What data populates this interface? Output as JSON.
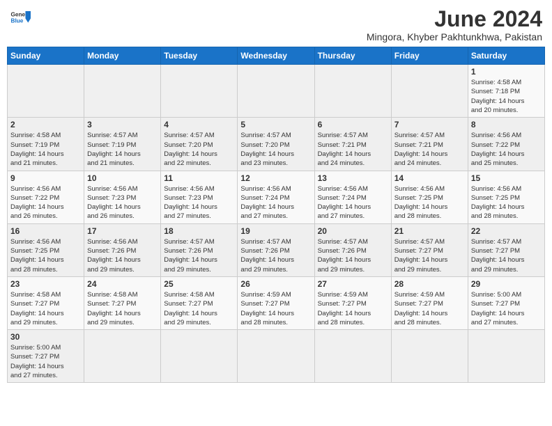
{
  "header": {
    "logo_general": "General",
    "logo_blue": "Blue",
    "month_title": "June 2024",
    "subtitle": "Mingora, Khyber Pakhtunkhwa, Pakistan"
  },
  "weekdays": [
    "Sunday",
    "Monday",
    "Tuesday",
    "Wednesday",
    "Thursday",
    "Friday",
    "Saturday"
  ],
  "weeks": [
    [
      {
        "day": "",
        "info": ""
      },
      {
        "day": "",
        "info": ""
      },
      {
        "day": "",
        "info": ""
      },
      {
        "day": "",
        "info": ""
      },
      {
        "day": "",
        "info": ""
      },
      {
        "day": "",
        "info": ""
      },
      {
        "day": "1",
        "info": "Sunrise: 4:58 AM\nSunset: 7:18 PM\nDaylight: 14 hours\nand 20 minutes."
      }
    ],
    [
      {
        "day": "2",
        "info": "Sunrise: 4:58 AM\nSunset: 7:19 PM\nDaylight: 14 hours\nand 21 minutes."
      },
      {
        "day": "3",
        "info": "Sunrise: 4:57 AM\nSunset: 7:19 PM\nDaylight: 14 hours\nand 21 minutes."
      },
      {
        "day": "4",
        "info": "Sunrise: 4:57 AM\nSunset: 7:20 PM\nDaylight: 14 hours\nand 22 minutes."
      },
      {
        "day": "5",
        "info": "Sunrise: 4:57 AM\nSunset: 7:20 PM\nDaylight: 14 hours\nand 23 minutes."
      },
      {
        "day": "6",
        "info": "Sunrise: 4:57 AM\nSunset: 7:21 PM\nDaylight: 14 hours\nand 24 minutes."
      },
      {
        "day": "7",
        "info": "Sunrise: 4:57 AM\nSunset: 7:21 PM\nDaylight: 14 hours\nand 24 minutes."
      },
      {
        "day": "8",
        "info": "Sunrise: 4:56 AM\nSunset: 7:22 PM\nDaylight: 14 hours\nand 25 minutes."
      }
    ],
    [
      {
        "day": "9",
        "info": "Sunrise: 4:56 AM\nSunset: 7:22 PM\nDaylight: 14 hours\nand 26 minutes."
      },
      {
        "day": "10",
        "info": "Sunrise: 4:56 AM\nSunset: 7:23 PM\nDaylight: 14 hours\nand 26 minutes."
      },
      {
        "day": "11",
        "info": "Sunrise: 4:56 AM\nSunset: 7:23 PM\nDaylight: 14 hours\nand 27 minutes."
      },
      {
        "day": "12",
        "info": "Sunrise: 4:56 AM\nSunset: 7:24 PM\nDaylight: 14 hours\nand 27 minutes."
      },
      {
        "day": "13",
        "info": "Sunrise: 4:56 AM\nSunset: 7:24 PM\nDaylight: 14 hours\nand 27 minutes."
      },
      {
        "day": "14",
        "info": "Sunrise: 4:56 AM\nSunset: 7:25 PM\nDaylight: 14 hours\nand 28 minutes."
      },
      {
        "day": "15",
        "info": "Sunrise: 4:56 AM\nSunset: 7:25 PM\nDaylight: 14 hours\nand 28 minutes."
      }
    ],
    [
      {
        "day": "16",
        "info": "Sunrise: 4:56 AM\nSunset: 7:25 PM\nDaylight: 14 hours\nand 28 minutes."
      },
      {
        "day": "17",
        "info": "Sunrise: 4:56 AM\nSunset: 7:26 PM\nDaylight: 14 hours\nand 29 minutes."
      },
      {
        "day": "18",
        "info": "Sunrise: 4:57 AM\nSunset: 7:26 PM\nDaylight: 14 hours\nand 29 minutes."
      },
      {
        "day": "19",
        "info": "Sunrise: 4:57 AM\nSunset: 7:26 PM\nDaylight: 14 hours\nand 29 minutes."
      },
      {
        "day": "20",
        "info": "Sunrise: 4:57 AM\nSunset: 7:26 PM\nDaylight: 14 hours\nand 29 minutes."
      },
      {
        "day": "21",
        "info": "Sunrise: 4:57 AM\nSunset: 7:27 PM\nDaylight: 14 hours\nand 29 minutes."
      },
      {
        "day": "22",
        "info": "Sunrise: 4:57 AM\nSunset: 7:27 PM\nDaylight: 14 hours\nand 29 minutes."
      }
    ],
    [
      {
        "day": "23",
        "info": "Sunrise: 4:58 AM\nSunset: 7:27 PM\nDaylight: 14 hours\nand 29 minutes."
      },
      {
        "day": "24",
        "info": "Sunrise: 4:58 AM\nSunset: 7:27 PM\nDaylight: 14 hours\nand 29 minutes."
      },
      {
        "day": "25",
        "info": "Sunrise: 4:58 AM\nSunset: 7:27 PM\nDaylight: 14 hours\nand 29 minutes."
      },
      {
        "day": "26",
        "info": "Sunrise: 4:59 AM\nSunset: 7:27 PM\nDaylight: 14 hours\nand 28 minutes."
      },
      {
        "day": "27",
        "info": "Sunrise: 4:59 AM\nSunset: 7:27 PM\nDaylight: 14 hours\nand 28 minutes."
      },
      {
        "day": "28",
        "info": "Sunrise: 4:59 AM\nSunset: 7:27 PM\nDaylight: 14 hours\nand 28 minutes."
      },
      {
        "day": "29",
        "info": "Sunrise: 5:00 AM\nSunset: 7:27 PM\nDaylight: 14 hours\nand 27 minutes."
      }
    ],
    [
      {
        "day": "30",
        "info": "Sunrise: 5:00 AM\nSunset: 7:27 PM\nDaylight: 14 hours\nand 27 minutes."
      },
      {
        "day": "",
        "info": ""
      },
      {
        "day": "",
        "info": ""
      },
      {
        "day": "",
        "info": ""
      },
      {
        "day": "",
        "info": ""
      },
      {
        "day": "",
        "info": ""
      },
      {
        "day": "",
        "info": ""
      }
    ]
  ]
}
